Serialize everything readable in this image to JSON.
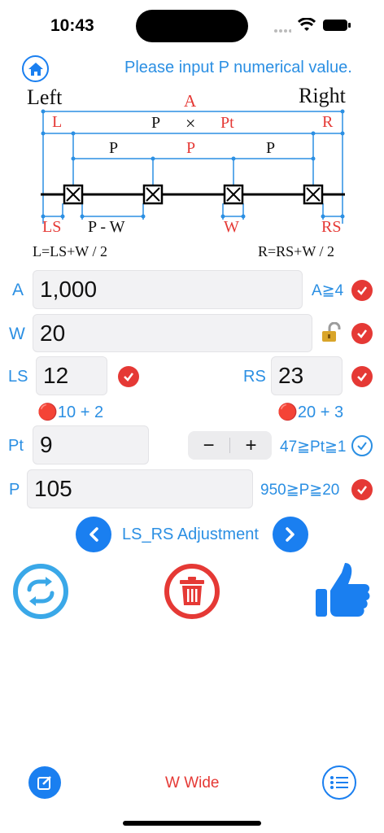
{
  "status_bar": {
    "time": "10:43"
  },
  "header": {
    "message": "Please input P numerical value."
  },
  "diagram": {
    "left": "Left",
    "right": "Right",
    "a": "A",
    "l": "L",
    "p": "P",
    "times": "×",
    "pt": "Pt",
    "r": "R",
    "p_red": "P",
    "ls": "LS",
    "p_minus_w": "P - W",
    "w": "W",
    "rs": "RS",
    "formula_left": "L=LS+W / 2",
    "formula_right": "R=RS+W / 2"
  },
  "fields": {
    "a": {
      "label": "A",
      "value": "1,000",
      "hint": "A≧4"
    },
    "w": {
      "label": "W",
      "value": "20"
    },
    "ls": {
      "label": "LS",
      "value": "12",
      "note": "🔴10 + 2"
    },
    "rs": {
      "label": "RS",
      "value": "23",
      "note": "🔴20 + 3"
    },
    "pt": {
      "label": "Pt",
      "value": "9",
      "minus": "−",
      "plus": "+",
      "hint": "47≧Pt≧1"
    },
    "p": {
      "label": "P",
      "value": "105",
      "hint": "950≧P≧20"
    }
  },
  "adjust": {
    "label": "LS_RS Adjustment"
  },
  "footer": {
    "center_label": "W Wide"
  },
  "colors": {
    "accent": "#2b8fe3",
    "danger": "#e53935",
    "button_blue": "#1a7ff0"
  }
}
